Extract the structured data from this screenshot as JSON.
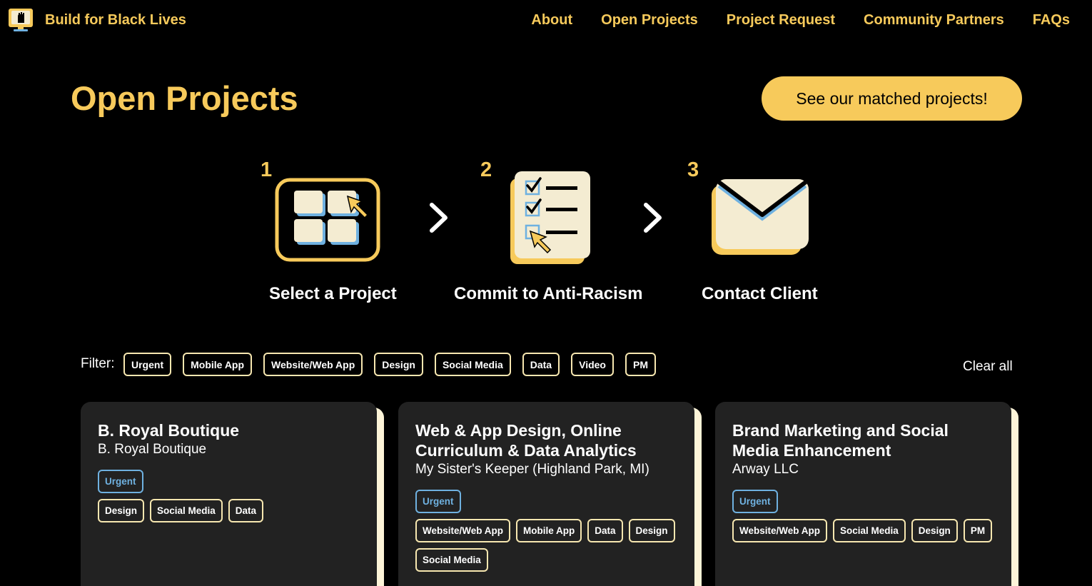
{
  "nav": {
    "brand": "Build for Black Lives",
    "links": [
      "About",
      "Open Projects",
      "Project Request",
      "Community Partners",
      "FAQs"
    ]
  },
  "header": {
    "title": "Open Projects",
    "cta_label": "See our matched projects!"
  },
  "steps": [
    {
      "number": "1",
      "label": "Select a Project",
      "icon": "grid-cursor-icon"
    },
    {
      "number": "2",
      "label": "Commit to Anti-Racism",
      "icon": "checklist-icon"
    },
    {
      "number": "3",
      "label": "Contact Client",
      "icon": "envelope-icon"
    }
  ],
  "filter": {
    "label": "Filter:",
    "chips": [
      "Urgent",
      "Mobile App",
      "Website/Web App",
      "Design",
      "Social Media",
      "Data",
      "Video",
      "PM"
    ],
    "clear_label": "Clear all"
  },
  "cards": [
    {
      "title": "B. Royal Boutique",
      "org": "B. Royal Boutique",
      "urgent": "Urgent",
      "tags": [
        "Design",
        "Social Media",
        "Data"
      ]
    },
    {
      "title": "Web & App Design, Online Curriculum & Data Analytics",
      "org": "My Sister's Keeper (Highland Park, MI)",
      "urgent": "Urgent",
      "tags": [
        "Website/Web App",
        "Mobile App",
        "Data",
        "Design",
        "Social Media"
      ]
    },
    {
      "title": "Brand Marketing and Social Media Enhancement",
      "org": "Arway LLC",
      "urgent": "Urgent",
      "tags": [
        "Website/Web App",
        "Social Media",
        "Design",
        "PM"
      ]
    }
  ],
  "colors": {
    "accent": "#f7ca5b",
    "urgent": "#6fb1e0",
    "card_bg": "#222222",
    "card_shadow": "#fdf4d8"
  }
}
